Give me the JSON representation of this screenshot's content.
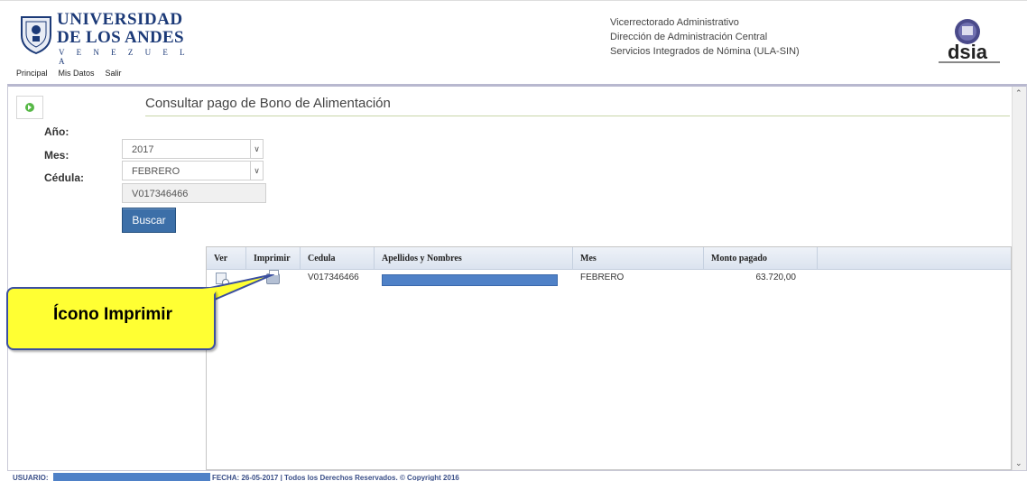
{
  "header": {
    "university": {
      "line1": "UNIVERSIDAD",
      "line2": "DE LOS ANDES",
      "line3": "V E N E Z U E L A"
    },
    "nav": [
      "Principal",
      "Mis Datos",
      "Salir"
    ],
    "department": [
      "Vicerrectorado Administrativo",
      "Dirección de Administración Central",
      "Servicios Integrados de Nómina (ULA-SIN)"
    ],
    "dsia_logo": "dsia"
  },
  "page": {
    "title": "Consultar pago de Bono de Alimentación",
    "back_icon": "play-circle-icon"
  },
  "form": {
    "year_label": "Año:",
    "year_value": "2017",
    "month_label": "Mes:",
    "month_value": "FEBRERO",
    "id_label": "Cédula:",
    "id_value": "V017346466",
    "search_button": "Buscar"
  },
  "grid": {
    "columns": [
      "Ver",
      "Imprimir",
      "Cedula",
      "Apellidos y Nombres",
      "Mes",
      "Monto pagado"
    ],
    "rows": [
      {
        "view_icon": "magnifier-icon",
        "print_icon": "printer-icon",
        "cedula": "V017346466",
        "name": "",
        "mes": "FEBRERO",
        "monto": "63.720,00"
      }
    ]
  },
  "callout": {
    "text": "Ícono Imprimir",
    "background": "#ffff33",
    "border": "#3b4fa0"
  },
  "footer": {
    "user_label": "USUARIO:",
    "date_text": "FECHA: 26-05-2017 | Todos los Derechos Reservados. © Copyright 2016"
  },
  "colors": {
    "brand_blue": "#1c3a78",
    "button_blue": "#3c6fa8",
    "redaction_blue": "#4f81c7"
  }
}
